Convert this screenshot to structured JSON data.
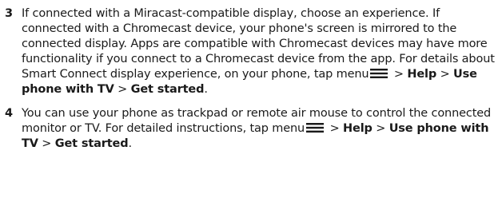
{
  "steps": [
    {
      "number": "3",
      "text_a": "If connected with a Miracast-compatible display, choose an experience. If connected with a Chromecast device, your phone's screen is mirrored to the connected display. Apps are compatible with Chromecast devices may have more functionality if you connect to a Chromecast device from the app. For details about Smart Connect display experience, on your phone, tap menu",
      "sep1": " > ",
      "bold1": "Help",
      "sep2": " > ",
      "bold2": "Use phone with TV",
      "sep3": " > ",
      "bold3": "Get started",
      "end": "."
    },
    {
      "number": "4",
      "text_a": "You can use your phone as trackpad or remote air mouse to control the connected monitor or TV. For detailed instructions, tap menu",
      "sep1": " > ",
      "bold1": "Help",
      "sep2": " > ",
      "bold2": "Use phone with TV",
      "sep3": " > ",
      "bold3": "Get started",
      "end": "."
    }
  ],
  "icons": {
    "menu": "hamburger-menu-icon"
  }
}
